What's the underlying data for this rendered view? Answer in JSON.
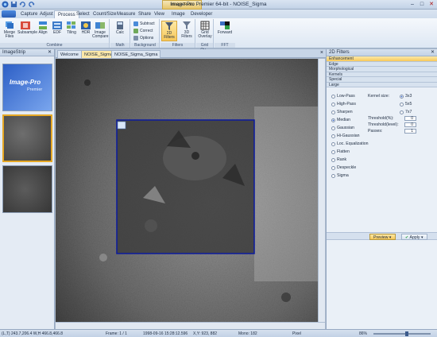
{
  "window": {
    "title": "Image-Pro Premier 64-bit - NOISE_Sigma",
    "context_tab": "Image Tools",
    "controls": {
      "minimize": "–",
      "maximize": "□",
      "close": "✕"
    }
  },
  "ribbon_tabs": [
    "Capture",
    "Adjust",
    "Process",
    "Select",
    "Count/Size",
    "Measure",
    "Share",
    "View",
    "Image",
    "Developer"
  ],
  "active_tab": "Process",
  "ribbon": {
    "combine": {
      "label": "Combine",
      "buttons": [
        "Merge Files",
        "Subsample",
        "Align",
        "EDF",
        "Tiling",
        "HDR",
        "Image Compare"
      ]
    },
    "math": {
      "label": "Math",
      "buttons": [
        "Calc"
      ]
    },
    "background": {
      "label": "Background",
      "items": [
        "Subtract",
        "Correct",
        "Options"
      ]
    },
    "filters": {
      "label": "Filters",
      "buttons": [
        "2D Filters",
        "3D Filters"
      ]
    },
    "grid_overlay": {
      "label": "Grid Ov...",
      "buttons": [
        "Grid Overlay"
      ]
    },
    "fft": {
      "label": "FFT",
      "buttons": [
        "Forward"
      ]
    }
  },
  "image_strip": {
    "title": "ImageStrip",
    "pin": "✕",
    "logo_line1": "Image-Pro",
    "logo_line2": "Premier"
  },
  "doc_tabs": [
    "Welcome",
    "NOISE_Sigma",
    "NOISE_Sigma_Sigma"
  ],
  "active_doc": "NOISE_Sigma",
  "doc_close": "×",
  "filters_panel": {
    "title": "2D Filters",
    "pin": "✕",
    "sections": [
      "Enhancement",
      "Edge",
      "Morphological",
      "Kernels",
      "Special",
      "Large"
    ],
    "active_section": "Enhancement",
    "filter_types": [
      "Low-Pass",
      "High-Pass",
      "Sharpen",
      "Median",
      "Gaussian",
      "Hi-Gaussian",
      "Loc. Equalization",
      "Flatten",
      "Rank",
      "Despeckle",
      "Sigma"
    ],
    "selected_filter": "Median",
    "kernel_label": "Kernel size:",
    "kernel_sizes": [
      "3x3",
      "5x5",
      "7x7"
    ],
    "selected_kernel": "3x3",
    "threshold_pct_label": "Threshold(%):",
    "threshold_pct": "0",
    "threshold_level_label": "Threshold(level):",
    "threshold_level": "0",
    "passes_label": "Passes:",
    "passes": "1",
    "preview_label": "Preview",
    "apply_label": "Apply"
  },
  "status_bar": {
    "coords": "(L,T) 243.7,206.4  W,H 466.8,466.8",
    "frame": "Frame: 1 / 1",
    "datetime": "1998-09-16 15:28:12.596",
    "xy": "X,Y: 923, 882",
    "mono": "Mono: 182",
    "units": "Pixel",
    "zoom": "86%"
  },
  "colors": {
    "accent": "#f7c85a",
    "selection_rect": "#0b1a9e",
    "ribbon_bg": "#dde7f3",
    "title_bg": "#c2d2e6"
  },
  "icons": [
    "save-icon",
    "undo-icon",
    "redo-icon",
    "pin-icon",
    "close-icon",
    "zoom-slider-icon"
  ]
}
